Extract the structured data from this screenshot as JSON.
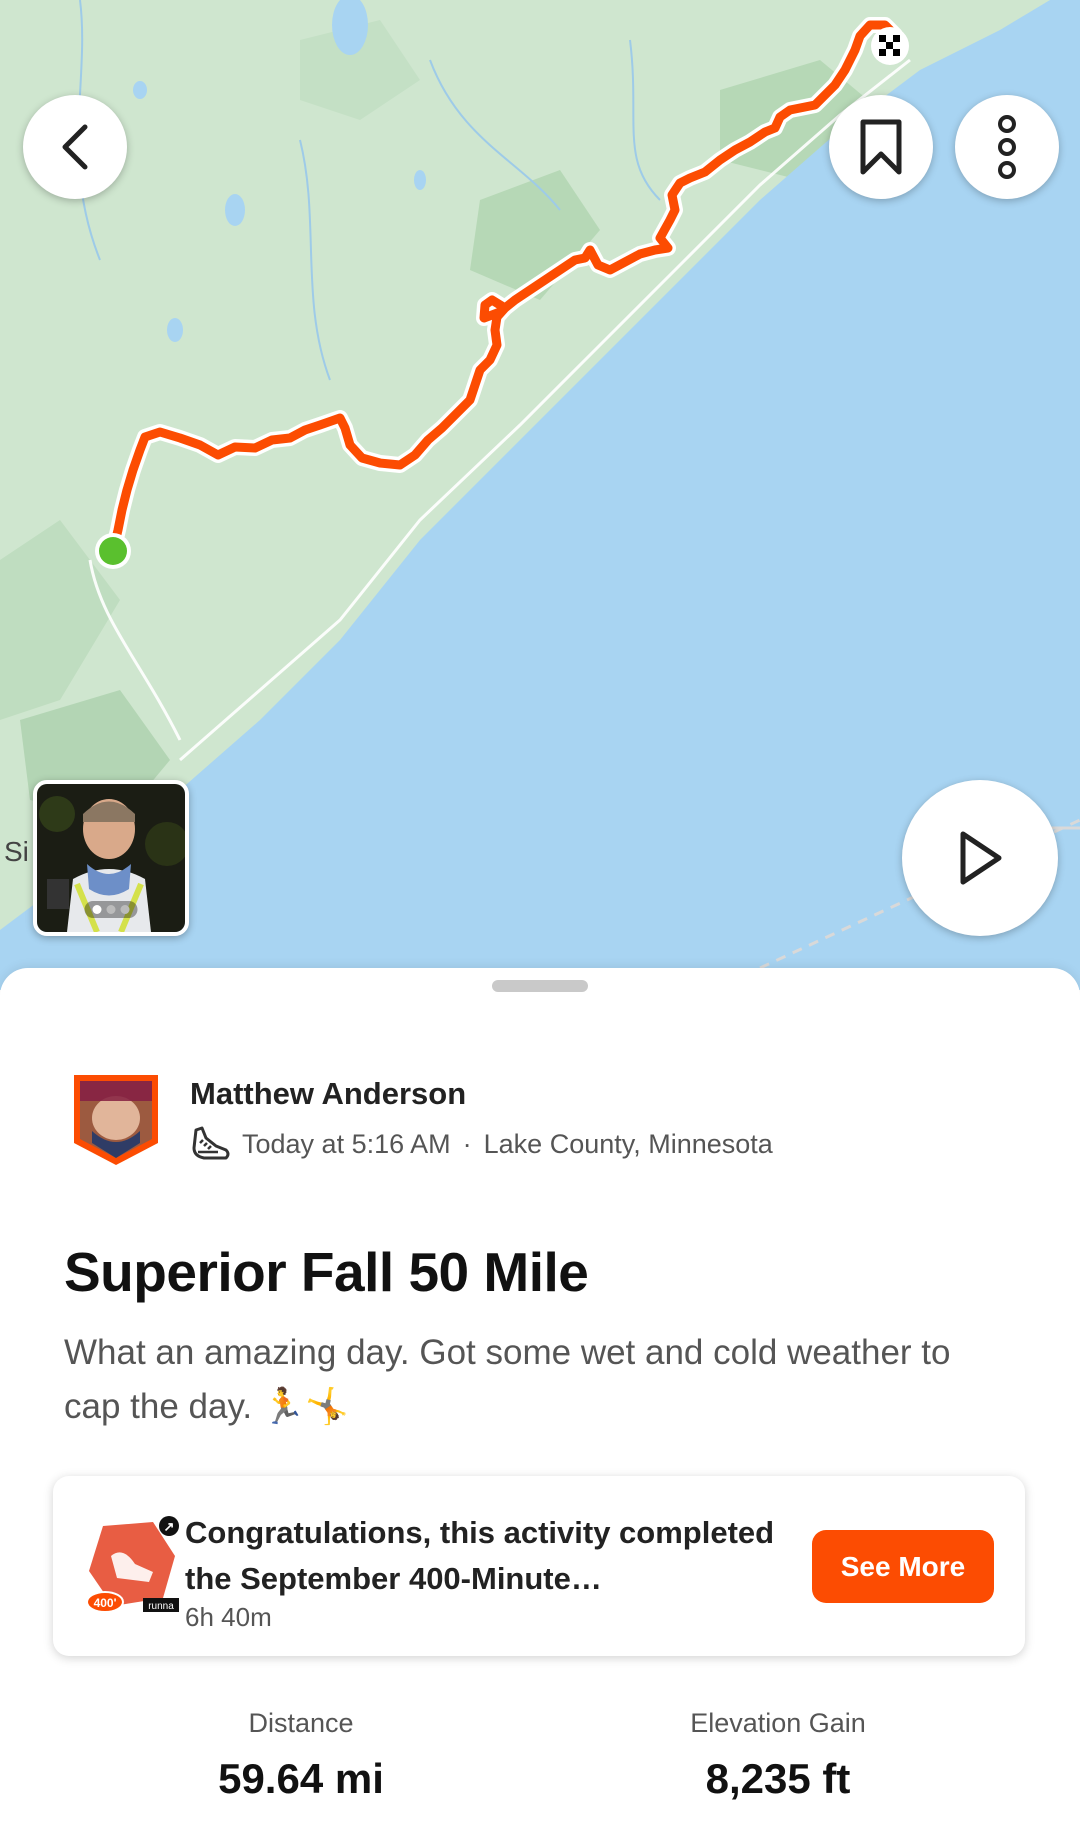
{
  "map": {
    "place_label": "Si",
    "photo_count": 3,
    "photo_active_index": 0
  },
  "colors": {
    "accent": "#fc4c02",
    "route": "#fc4c02",
    "start": "#5ac02e",
    "water": "#a8d4f2",
    "land": "#cfe6cf"
  },
  "icons": {
    "back": "chevron-left-icon",
    "bookmark": "bookmark-icon",
    "more": "more-vertical-icon",
    "play": "play-icon",
    "activity": "running-shoe-icon",
    "finish": "checkered-flag-icon"
  },
  "athlete": {
    "name": "Matthew Anderson",
    "time": "Today at 5:16 AM",
    "separator": "·",
    "location": "Lake County, Minnesota"
  },
  "activity": {
    "title": "Superior Fall 50 Mile",
    "description": "What an amazing day. Got some wet and cold weather to cap the day. 🏃🤸"
  },
  "challenge": {
    "message": "Congratulations, this activity completed the September 400-Minute…",
    "duration": "6h 40m",
    "button": "See More",
    "badge_label": "400'",
    "badge_brand": "runna"
  },
  "stats": [
    {
      "label": "Distance",
      "value": "59.64 mi"
    },
    {
      "label": "Elevation Gain",
      "value": "8,235 ft"
    }
  ]
}
